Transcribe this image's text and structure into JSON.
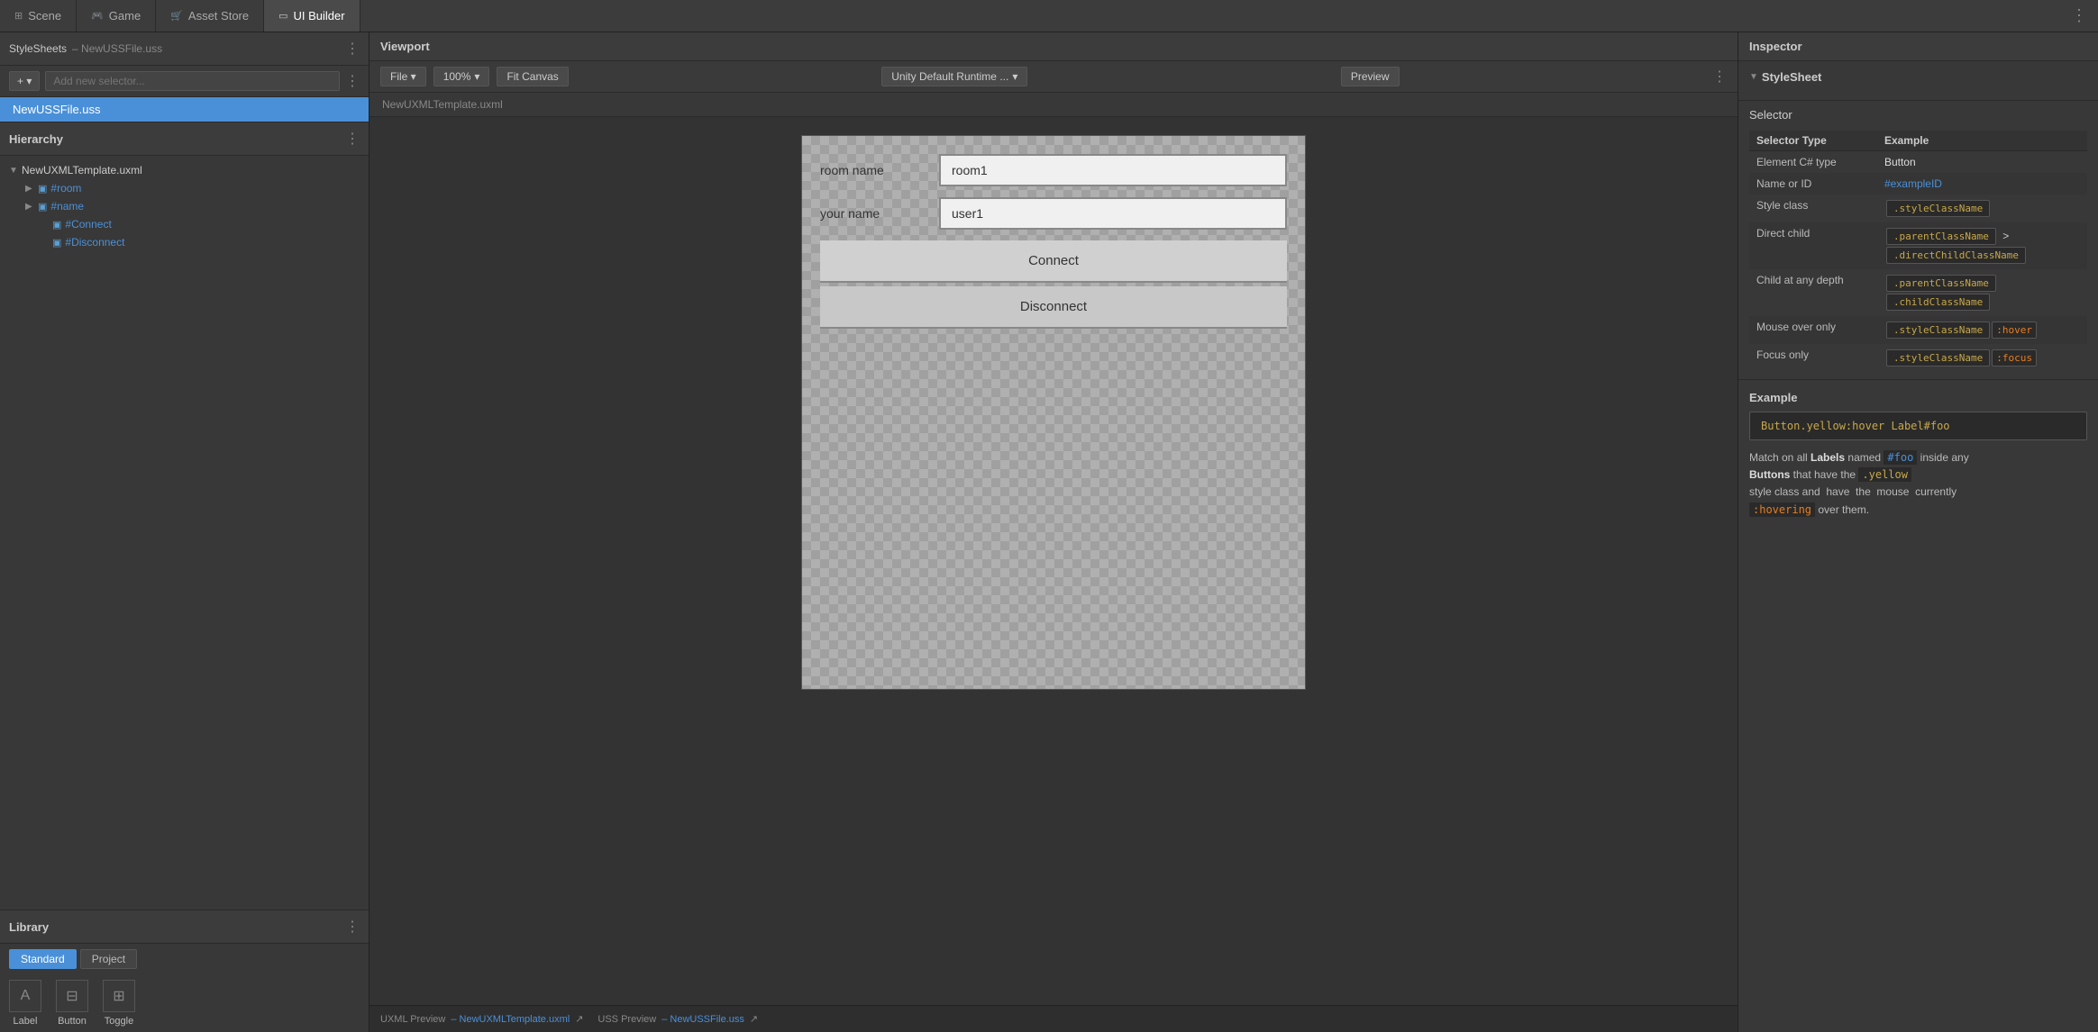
{
  "tabs": [
    {
      "id": "scene",
      "label": "Scene",
      "icon": "⊞",
      "active": false
    },
    {
      "id": "game",
      "label": "Game",
      "icon": "🎮",
      "active": false
    },
    {
      "id": "asset-store",
      "label": "Asset Store",
      "icon": "🛒",
      "active": false
    },
    {
      "id": "ui-builder",
      "label": "UI Builder",
      "icon": "▭",
      "active": true
    }
  ],
  "tab_dots": "⋮",
  "left_panel": {
    "stylesheets_title": "StyleSheets",
    "stylesheets_file": "– NewUSSFile.uss",
    "selector_placeholder": "Add new selector...",
    "add_button": "+  ▾",
    "uss_file": "NewUSSFile.uss",
    "hierarchy_title": "Hierarchy",
    "hierarchy_dots": "⋮",
    "tree": [
      {
        "id": "root",
        "label": "NewUXMLTemplate.uxml",
        "level": "root",
        "icon": "▼",
        "node_icon": ""
      },
      {
        "id": "room",
        "label": "#room",
        "level": "level1",
        "icon": "▶",
        "node_icon": "▣",
        "colored": true
      },
      {
        "id": "name",
        "label": "#name",
        "level": "level1",
        "icon": "▶",
        "node_icon": "▣",
        "colored": true
      },
      {
        "id": "connect",
        "label": "#Connect",
        "level": "level2",
        "icon": "",
        "node_icon": "▣",
        "colored": true
      },
      {
        "id": "disconnect",
        "label": "#Disconnect",
        "level": "level2",
        "icon": "",
        "node_icon": "▣",
        "colored": true
      }
    ],
    "library_title": "Library",
    "library_dots": "⋮",
    "library_tabs": [
      {
        "id": "standard",
        "label": "Standard",
        "active": true
      },
      {
        "id": "project",
        "label": "Project",
        "active": false
      }
    ],
    "library_items": [
      {
        "id": "label",
        "label": "Label",
        "icon": "A"
      },
      {
        "id": "button",
        "label": "Button",
        "icon": "⊟"
      },
      {
        "id": "toggle",
        "label": "Toggle",
        "icon": "⊞"
      }
    ]
  },
  "viewport": {
    "title": "Viewport",
    "file_btn": "File  ▾",
    "zoom": "100%",
    "zoom_arrow": "▾",
    "fit_canvas": "Fit Canvas",
    "runtime_dropdown": "Unity Default Runtime ...",
    "runtime_arrow": "▾",
    "preview_btn": "Preview",
    "dots": "⋮",
    "canvas_filename": "NewUXMLTemplate.uxml",
    "form": {
      "room_label": "room name",
      "room_value": "room1",
      "name_label": "your name",
      "name_value": "user1",
      "connect_btn": "Connect",
      "disconnect_btn": "Disconnect"
    }
  },
  "bottom_bar": {
    "uxml_label": "UXML Preview",
    "uxml_file": "– NewUXMLTemplate.uxml",
    "uss_label": "USS Preview",
    "uss_file": "– NewUSSFile.uss"
  },
  "inspector": {
    "title": "Inspector",
    "stylesheet_label": "StyleSheet",
    "selector_label": "Selector",
    "table": {
      "col1": "Selector Type",
      "col2": "Example",
      "rows": [
        {
          "type": "Element C# type",
          "example_text": "Button",
          "example_class": "plain"
        },
        {
          "type": "Name or ID",
          "example_text": "#exampleID",
          "example_class": "id"
        },
        {
          "type": "Style class",
          "example_text": ".styleClassName",
          "example_class": "badge-yellow"
        },
        {
          "type": "Direct child",
          "example_part1": ".parentClassName",
          "op": ">",
          "example_part2": ".directChildClassName",
          "example_class": "two-part"
        },
        {
          "type": "Child at any depth",
          "example_part1": ".parentClassName",
          "example_part2": ".childClassName",
          "example_class": "two-part-no-op"
        },
        {
          "type": "Mouse over only",
          "example_text": ".styleClassName",
          "pseudo": ":hover",
          "example_class": "badge-with-pseudo"
        },
        {
          "type": "Focus only",
          "example_text": ".styleClassName",
          "pseudo": ":focus",
          "example_class": "badge-with-pseudo"
        }
      ]
    },
    "example": {
      "title": "Example",
      "code": "Button.yellow:hover Label#foo",
      "desc_parts": [
        {
          "text": "Match on all "
        },
        {
          "text": "Labels",
          "bold": true
        },
        {
          "text": " named "
        },
        {
          "text": "#foo",
          "highlight": "blue"
        },
        {
          "text": " inside any"
        },
        {
          "text": "\n"
        },
        {
          "text": "Buttons",
          "bold": true
        },
        {
          "text": " that have the "
        },
        {
          "text": ".yellow",
          "highlight": "yellow"
        },
        {
          "text": "\nstyle class and  have  the  mouse  currently"
        },
        {
          "text": "\n"
        },
        {
          "text": ":hovering",
          "highlight": "orange"
        },
        {
          "text": " over them."
        }
      ]
    }
  }
}
